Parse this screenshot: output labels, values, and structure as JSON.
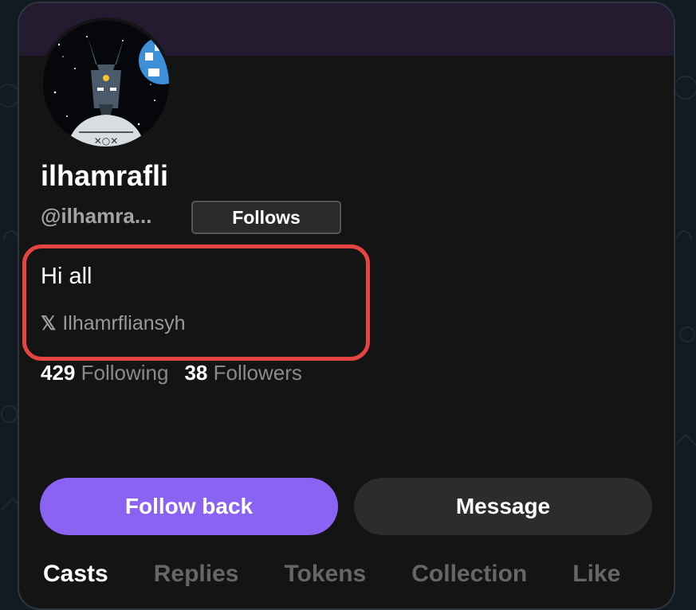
{
  "profile": {
    "display_name": "ilhamrafli",
    "handle": "@ilhamra...",
    "follows_badge": "Follows",
    "bio": "Hi all",
    "social": {
      "icon": "x-logo-icon",
      "icon_glyph": "𝕏",
      "username": "Ilhamrfliansyh"
    },
    "stats": {
      "following_count": "429",
      "following_label": "Following",
      "followers_count": "38",
      "followers_label": "Followers"
    }
  },
  "actions": {
    "follow_back_label": "Follow back",
    "message_label": "Message"
  },
  "tabs": [
    {
      "label": "Casts",
      "active": true
    },
    {
      "label": "Replies",
      "active": false
    },
    {
      "label": "Tokens",
      "active": false
    },
    {
      "label": "Collection",
      "active": false
    },
    {
      "label": "Like",
      "active": false
    }
  ],
  "colors": {
    "accent": "#8a63f2",
    "highlight": "#e5443f",
    "card_background": "#141414",
    "banner": "#241b30"
  }
}
